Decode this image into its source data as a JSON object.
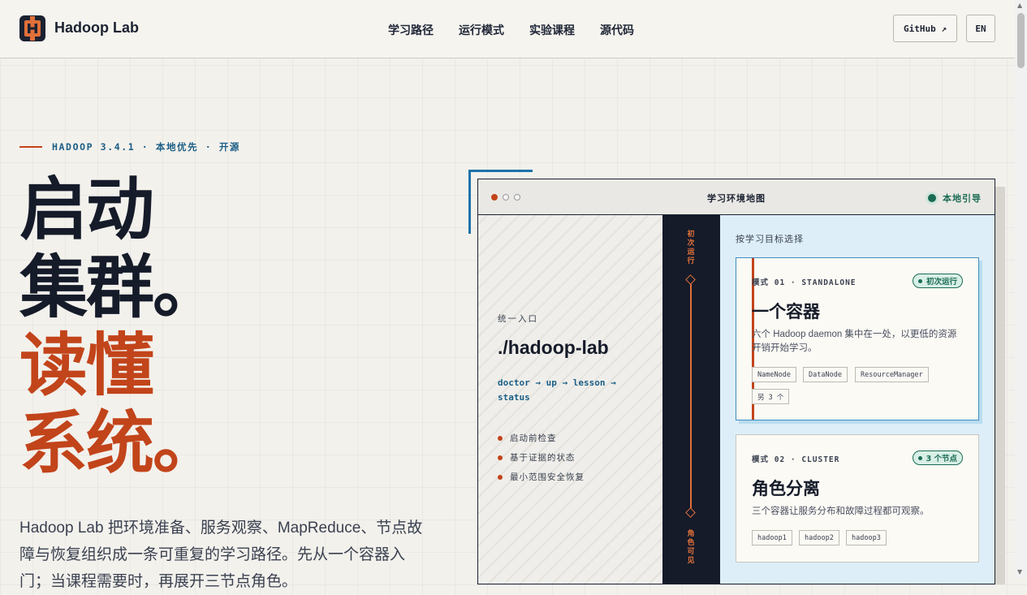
{
  "nav": {
    "brand": "Hadoop Lab",
    "logo_letter": "H",
    "items": [
      "学习路径",
      "运行模式",
      "实验课程",
      "源代码"
    ],
    "github": "GitHub ↗",
    "lang": "EN"
  },
  "hero": {
    "eyebrow": "HADOOP 3.4.1 · 本地优先 · 开源",
    "title_lines": [
      "启动",
      "集群。",
      "读懂",
      "系统。"
    ],
    "intro": "Hadoop Lab 把环境准备、服务观察、MapReduce、节点故障与恢复组织成一条可重复的学习路径。先从一个容器入门；当课程需要时，再展开三节点角色。"
  },
  "map": {
    "title": "学习环境地图",
    "local_guide": "本地引导",
    "entry": {
      "label": "统一入口",
      "command": "./hadoop-lab",
      "flow": "doctor → up → lesson → status",
      "features": [
        "启动前检查",
        "基于证据的状态",
        "最小范围安全恢复"
      ]
    },
    "track": {
      "top": "初次运行",
      "bottom": "角色可见"
    },
    "pick_label": "按学习目标选择",
    "cards": [
      {
        "meta": "模式 01 · STANDALONE",
        "badge": "初次运行",
        "title": "一个容器",
        "desc": "六个 Hadoop daemon 集中在一处，以更低的资源开销开始学习。",
        "tags": [
          "NameNode",
          "DataNode",
          "ResourceManager",
          "另 3 个"
        ]
      },
      {
        "meta": "模式 02 · CLUSTER",
        "badge": "3 个节点",
        "title": "角色分离",
        "desc": "三个容器让服务分布和故障过程都可观察。",
        "tags": [
          "hadoop1",
          "hadoop2",
          "hadoop3"
        ]
      }
    ]
  },
  "colors": {
    "accent": "#c2441a",
    "blue": "#1b5e86",
    "green": "#1a6b55",
    "ink": "#151b29"
  },
  "icons": [
    "hadoop-logo-icon",
    "external-link-icon"
  ]
}
